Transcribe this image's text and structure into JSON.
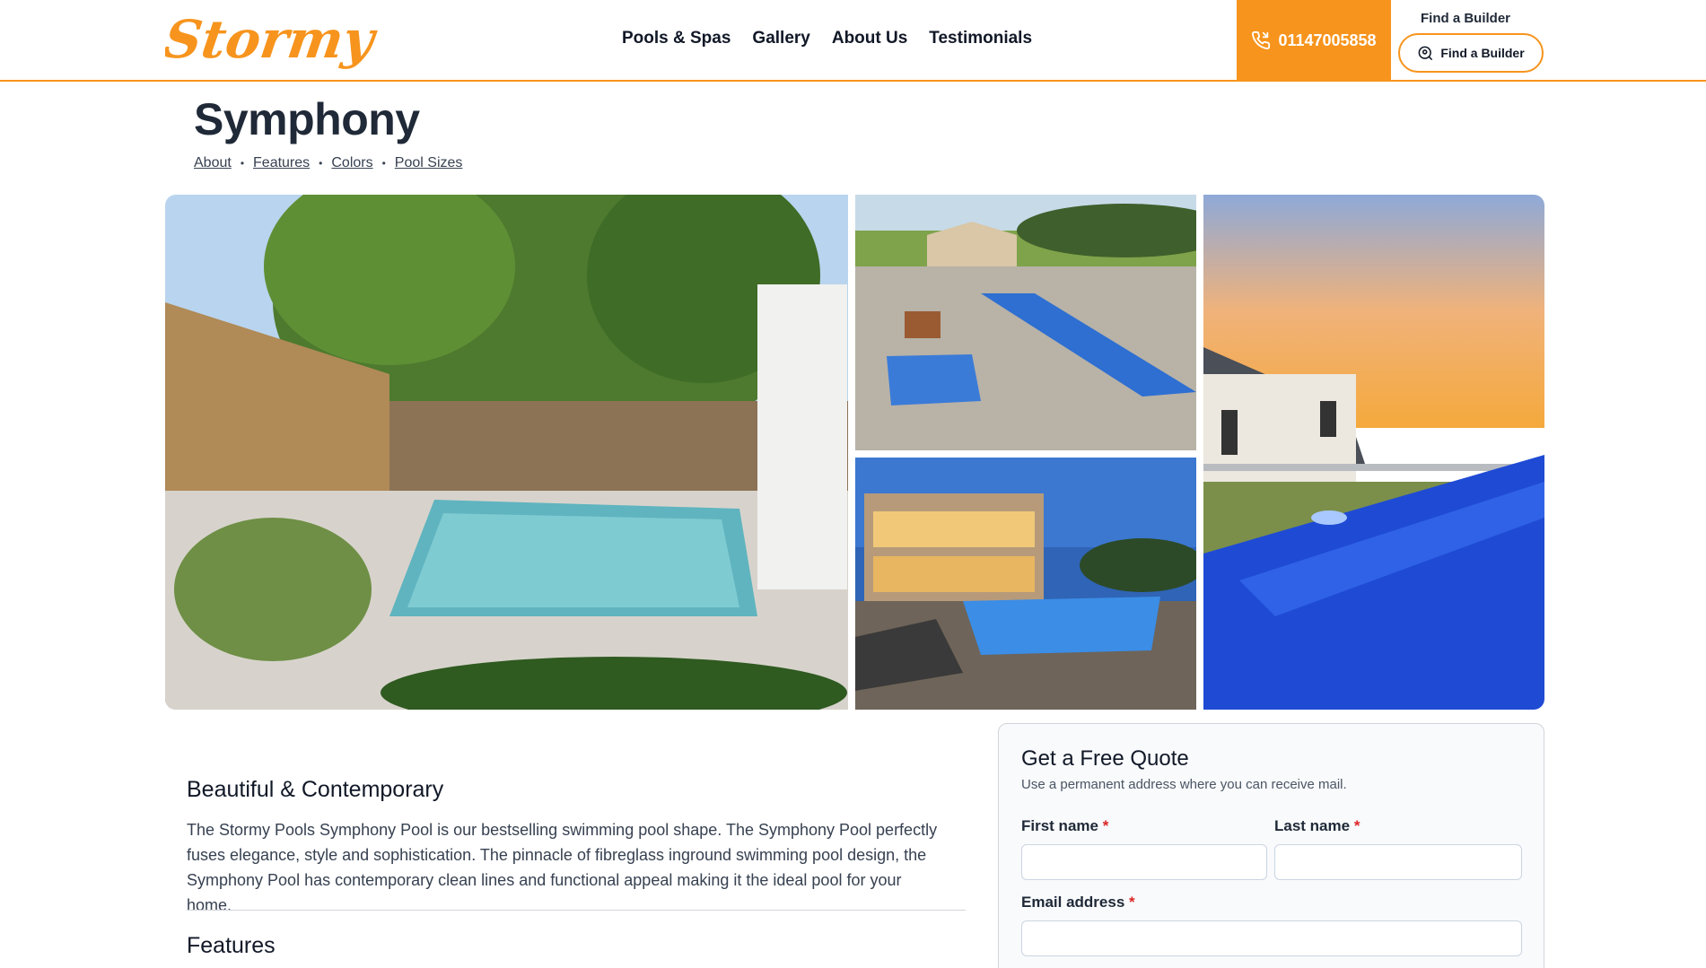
{
  "header": {
    "logo_text": "Stormy",
    "nav": [
      "Pools & Spas",
      "Gallery",
      "About Us",
      "Testimonials"
    ],
    "phone": "01147005858",
    "builder_label": "Find a Builder",
    "builder_button": "Find a Builder"
  },
  "page": {
    "title": "Symphony",
    "subnav": [
      "About",
      "Features",
      "Colors",
      "Pool Sizes"
    ]
  },
  "content": {
    "heading": "Beautiful & Contemporary",
    "intro": "The Stormy Pools Symphony Pool is our bestselling swimming pool shape. The Symphony Pool perfectly fuses elegance, style and sophistication. The pinnacle of fibreglass inground swimming pool design, the Symphony Pool has contemporary clean lines and functional appeal making it the ideal pool for your home.",
    "features_heading": "Features"
  },
  "quote": {
    "title": "Get a Free Quote",
    "subtitle": "Use a permanent address where you can receive mail.",
    "first_name_label": "First name",
    "last_name_label": "Last name",
    "email_label": "Email address",
    "required_mark": "*"
  },
  "colors": {
    "accent": "#f7941d",
    "text_dark": "#111827"
  }
}
